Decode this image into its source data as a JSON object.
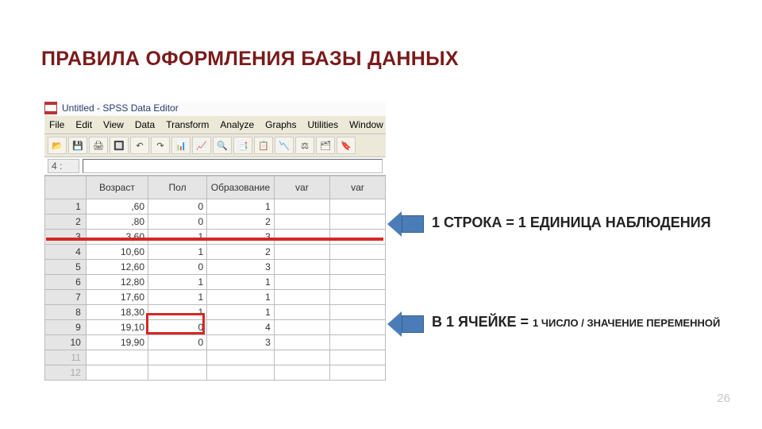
{
  "title": "ПРАВИЛА ОФОРМЛЕНИЯ БАЗЫ ДАННЫХ",
  "app": {
    "title": "Untitled - SPSS Data Editor",
    "menu": [
      "File",
      "Edit",
      "View",
      "Data",
      "Transform",
      "Analyze",
      "Graphs",
      "Utilities",
      "Window"
    ],
    "toolbar_icons": [
      "📂",
      "💾",
      "🖨",
      "🔲",
      "↶",
      "↷",
      "📊",
      "📈",
      "🔍",
      "📑",
      "📋",
      "📉",
      "⚖",
      "🗂",
      "🔖"
    ],
    "cell_address": "4 :"
  },
  "table": {
    "headers": [
      "",
      "Возраст",
      "Пол",
      "Образование",
      "var",
      "var"
    ],
    "rows": [
      {
        "n": "1",
        "age": ",60",
        "pol": "0",
        "edu": "1",
        "v1": "",
        "v2": ""
      },
      {
        "n": "2",
        "age": ",80",
        "pol": "0",
        "edu": "2",
        "v1": "",
        "v2": ""
      },
      {
        "n": "3",
        "age": "3,60",
        "pol": "1",
        "edu": "3",
        "v1": "",
        "v2": ""
      },
      {
        "n": "4",
        "age": "10,60",
        "pol": "1",
        "edu": "2",
        "v1": "",
        "v2": ""
      },
      {
        "n": "5",
        "age": "12,60",
        "pol": "0",
        "edu": "3",
        "v1": "",
        "v2": ""
      },
      {
        "n": "6",
        "age": "12,80",
        "pol": "1",
        "edu": "1",
        "v1": "",
        "v2": ""
      },
      {
        "n": "7",
        "age": "17,60",
        "pol": "1",
        "edu": "1",
        "v1": "",
        "v2": ""
      },
      {
        "n": "8",
        "age": "18,30",
        "pol": "1",
        "edu": "1",
        "v1": "",
        "v2": ""
      },
      {
        "n": "9",
        "age": "19,10",
        "pol": "0",
        "edu": "4",
        "v1": "",
        "v2": ""
      },
      {
        "n": "10",
        "age": "19,90",
        "pol": "0",
        "edu": "3",
        "v1": "",
        "v2": ""
      },
      {
        "n": "11",
        "age": "",
        "pol": "",
        "edu": "",
        "v1": "",
        "v2": "",
        "gray": true
      },
      {
        "n": "12",
        "age": "",
        "pol": "",
        "edu": "",
        "v1": "",
        "v2": "",
        "gray": true
      }
    ]
  },
  "captions": {
    "row": "1 СТРОКА = 1 ЕДИНИЦА НАБЛЮДЕНИЯ",
    "cell_big": "В 1 ЯЧЕЙКЕ = ",
    "cell_small": "1 ЧИСЛО / ЗНАЧЕНИЕ ПЕРЕМЕННОЙ"
  },
  "page": "26",
  "colors": {
    "accent": "#7a1a1a",
    "highlight": "#d62727",
    "arrow": "#4a7db7"
  }
}
